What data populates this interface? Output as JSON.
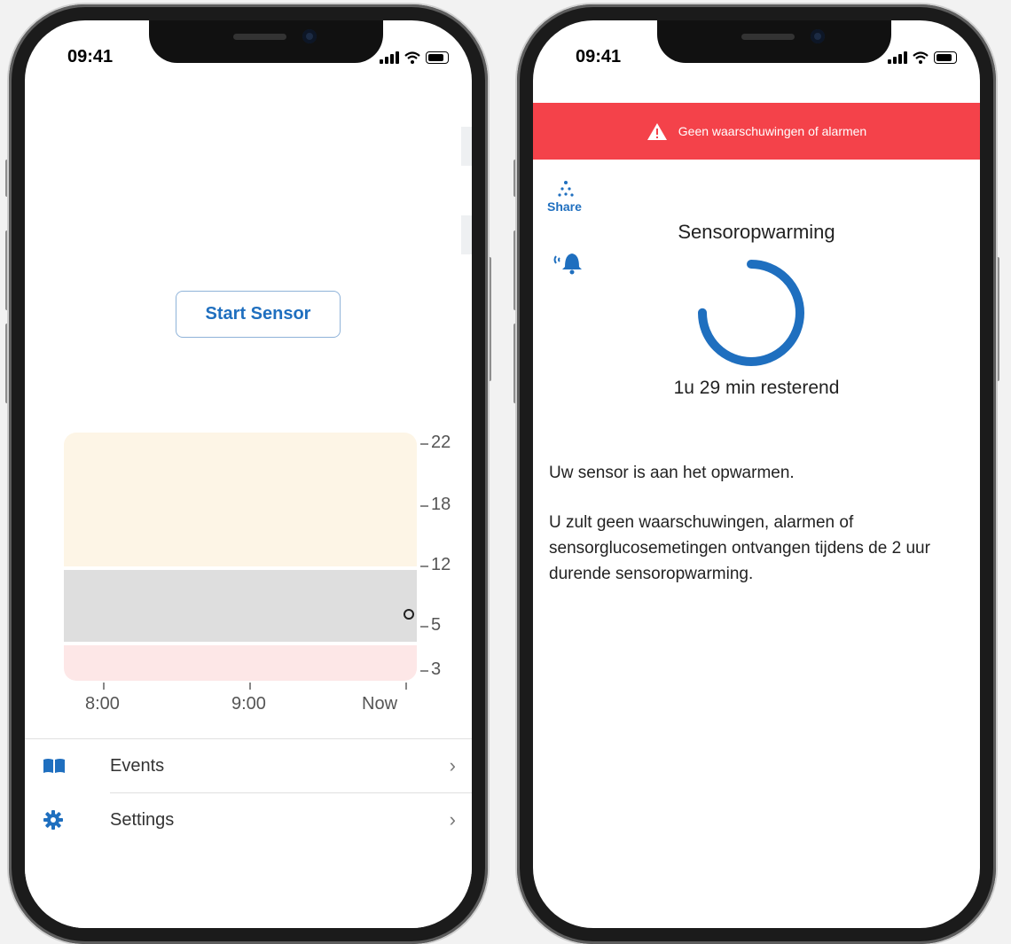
{
  "status_bar": {
    "time": "09:41"
  },
  "left_screen": {
    "start_button_label": "Start Sensor",
    "chart_data": {
      "type": "line",
      "x_ticks": [
        "8:00",
        "9:00",
        "Now"
      ],
      "y_ticks": [
        22,
        18,
        12,
        5,
        3
      ],
      "bands": [
        {
          "from": 12,
          "to": 22,
          "color": "#fdf5e6"
        },
        {
          "from": 5,
          "to": 12,
          "color": "#dedede"
        },
        {
          "from": 3,
          "to": 5,
          "color": "#fde7e7"
        }
      ],
      "points": [
        {
          "x": "Now",
          "y": 6.3
        }
      ]
    },
    "menu": [
      {
        "label": "Events",
        "icon": "book-icon"
      },
      {
        "label": "Settings",
        "icon": "gear-icon"
      }
    ]
  },
  "right_screen": {
    "banner_text": "Geen waarschuwingen of alarmen",
    "share_label": "Share",
    "title": "Sensoropwarming",
    "remaining": "1u 29 min resterend",
    "message1": "Uw sensor is aan het opwarmen.",
    "message2": "U zult geen waarschuwingen, alarmen of sensorglucosemetingen ontvangen tijdens de 2 uur durende sensoropwarming.",
    "progress_fraction": 0.25,
    "accent_color": "#1f6fbf",
    "banner_color": "#f4424a"
  }
}
